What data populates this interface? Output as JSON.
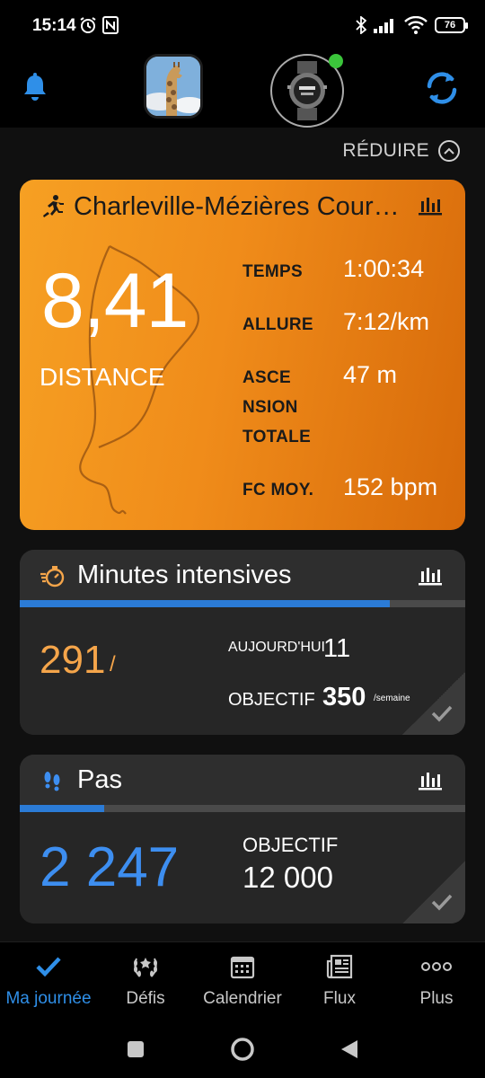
{
  "status_bar": {
    "time": "15:14",
    "battery": "76"
  },
  "header": {
    "avatar_icon": "profile-photo-giraffe",
    "device_icon": "watch-icon"
  },
  "reduire_label": "RÉDUIRE",
  "activity": {
    "title": "Charleville-Mézières Cour…",
    "distance_value": "8,41",
    "distance_label": "DISTANCE",
    "stats": [
      {
        "label_lines": [
          "TEMPS"
        ],
        "value": "1:00:34"
      },
      {
        "label_lines": [
          "ALLURE"
        ],
        "value": "7:12/km"
      },
      {
        "label_lines": [
          "ASCE",
          "NSION",
          "TOTALE"
        ],
        "value": "47 m"
      },
      {
        "label_lines": [
          "FC MOY."
        ],
        "value": "152 bpm"
      }
    ],
    "colors": {
      "start": "#f6a023",
      "end": "#d76a0a"
    }
  },
  "intensive": {
    "title": "Minutes intensives",
    "value": "291",
    "slash": "/",
    "today_label": "AUJOURD'HUI",
    "today_value": "11",
    "goal_label": "OBJECTIF",
    "goal_value": "350",
    "goal_unit": "/semaine",
    "progress": 0.83,
    "value_color": "#f5a54a"
  },
  "steps": {
    "title": "Pas",
    "value": "2 247",
    "goal_label": "OBJECTIF",
    "goal_value": "12 000",
    "progress": 0.19,
    "value_color": "#3d8ef0"
  },
  "bottom_nav": [
    {
      "label": "Ma journée",
      "icon": "check-icon",
      "active": true
    },
    {
      "label": "Défis",
      "icon": "laurel-icon",
      "active": false
    },
    {
      "label": "Calendrier",
      "icon": "calendar-icon",
      "active": false
    },
    {
      "label": "Flux",
      "icon": "newsfeed-icon",
      "active": false
    },
    {
      "label": "Plus",
      "icon": "more-icon",
      "active": false
    }
  ]
}
